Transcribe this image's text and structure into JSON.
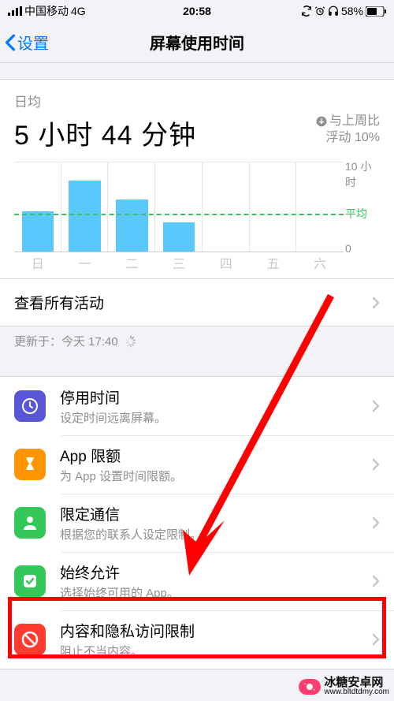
{
  "status": {
    "carrier": "中国移动",
    "network": "4G",
    "time": "20:58",
    "battery_pct": "58%"
  },
  "nav": {
    "back": "设置",
    "title": "屏幕使用时间"
  },
  "summary": {
    "daily_avg_label": "日均",
    "daily_avg_value": "5 小时 44 分钟",
    "delta_line1": "与上周比",
    "delta_line2": "浮动 10%"
  },
  "chart_data": {
    "type": "bar",
    "categories": [
      "日",
      "一",
      "二",
      "三",
      "四",
      "五",
      "六"
    ],
    "values": [
      4.5,
      8.0,
      5.8,
      3.3,
      0,
      0,
      0
    ],
    "y_top_label": "10 小时",
    "avg_label": "平均",
    "zero_label": "0",
    "ylim": [
      0,
      10
    ]
  },
  "view_all": {
    "label": "查看所有活动"
  },
  "updated": {
    "prefix": "更新于：",
    "time": "今天 17:40"
  },
  "settings": [
    {
      "key": "downtime",
      "title": "停用时间",
      "sub": "设定时间远离屏幕。",
      "bg": "#5856d6"
    },
    {
      "key": "applimits",
      "title": "App 限额",
      "sub": "为 App 设置时间限额。",
      "bg": "#ff9500"
    },
    {
      "key": "comm",
      "title": "限定通信",
      "sub": "根据您的联系人设定限制。",
      "bg": "#34c759"
    },
    {
      "key": "always",
      "title": "始终允许",
      "sub": "选择始终可用的 App。",
      "bg": "#34c759"
    },
    {
      "key": "content",
      "title": "内容和隐私访问限制",
      "sub": "阻止不当内容。",
      "bg": "#ff3b30"
    }
  ],
  "watermark": {
    "brand": "冰糖安卓网",
    "url": "www.bltdtdmy.com"
  }
}
